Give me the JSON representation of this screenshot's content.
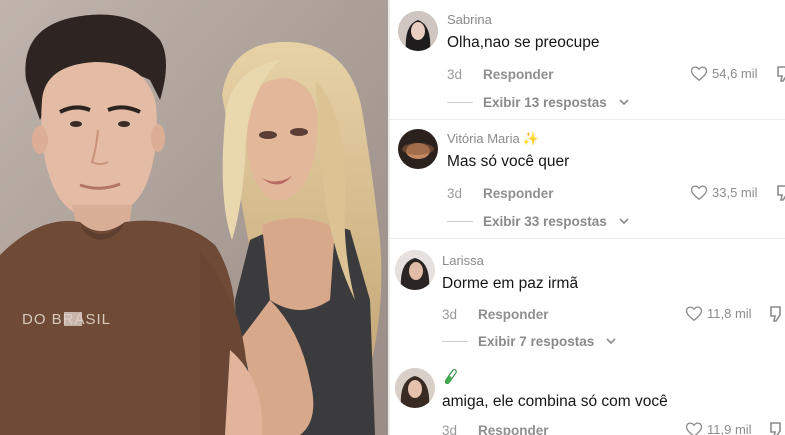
{
  "comments": [
    {
      "author": "Sabrina",
      "text": "Olha,nao se preocupe",
      "time": "3d",
      "reply_label": "Responder",
      "likes": "54,6 mil",
      "thread_label": "Exibir 13 respostas"
    },
    {
      "author": "Vitória Maria",
      "author_badge": "sparkles",
      "text": "Mas só você quer",
      "time": "3d",
      "reply_label": "Responder",
      "likes": "33,5 mil",
      "thread_label": "Exibir 33 respostas"
    },
    {
      "author": "Larissa",
      "text": "Dorme em paz irmã",
      "time": "3d",
      "reply_label": "Responder",
      "likes": "11,8 mil",
      "thread_label": "Exibir 7 respostas"
    },
    {
      "author_badge": "test-tube",
      "text": "amiga, ele combina só com você",
      "time": "3d",
      "reply_label": "Responder",
      "likes": "11,9 mil"
    }
  ],
  "photo": {
    "shirt_text": "DO BRASIL"
  },
  "colors": {
    "text_primary": "#161616",
    "text_secondary": "#8a8a8a",
    "shirt_brown": "#6e4a37",
    "background": "#ffffff"
  }
}
